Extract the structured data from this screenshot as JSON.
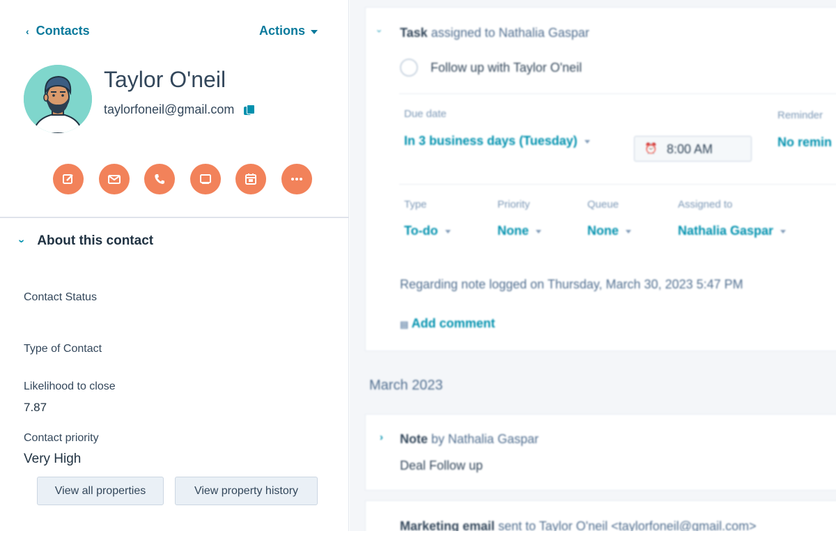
{
  "contact": {
    "back_label": "Contacts",
    "actions_label": "Actions",
    "name": "Taylor O'neil",
    "email": "taylorfoneil@gmail.com"
  },
  "quick_actions": [
    "note-icon",
    "email-icon",
    "call-icon",
    "task-icon",
    "meeting-icon",
    "more-icon"
  ],
  "about": {
    "title": "About this contact",
    "properties": [
      {
        "label": "Contact Status",
        "value": ""
      },
      {
        "label": "Type of Contact",
        "value": ""
      },
      {
        "label": "Likelihood to close",
        "value": "7.87"
      },
      {
        "label": "Contact priority",
        "value": "Very High"
      }
    ],
    "view_all_label": "View all properties",
    "view_history_label": "View property history"
  },
  "timeline": {
    "task": {
      "kind": "Task",
      "assigned_text": "assigned to Nathalia Gaspar",
      "title": "Follow up with Taylor O'neil",
      "due_label": "Due date",
      "due_value": "In 3 business days (Tuesday)",
      "time_value": "8:00 AM",
      "reminder_label": "Reminder",
      "reminder_value": "No remin",
      "type_label": "Type",
      "type_value": "To-do",
      "priority_label": "Priority",
      "priority_value": "None",
      "queue_label": "Queue",
      "queue_value": "None",
      "assigned_label": "Assigned to",
      "assigned_value": "Nathalia Gaspar",
      "regarding": "Regarding note logged on Thursday, March 30, 2023 5:47 PM",
      "add_comment": "Add comment"
    },
    "month_header": "March 2023",
    "note": {
      "kind": "Note",
      "by_text": "by Nathalia Gaspar",
      "body": "Deal Follow up"
    },
    "email": {
      "kind": "Marketing email",
      "sent_text": "sent to Taylor O'neil <taylorfoneil@gmail.com>"
    }
  },
  "colors": {
    "accent": "#0091ae",
    "action_button": "#f2825a",
    "avatar_bg": "#7fd6cc"
  }
}
